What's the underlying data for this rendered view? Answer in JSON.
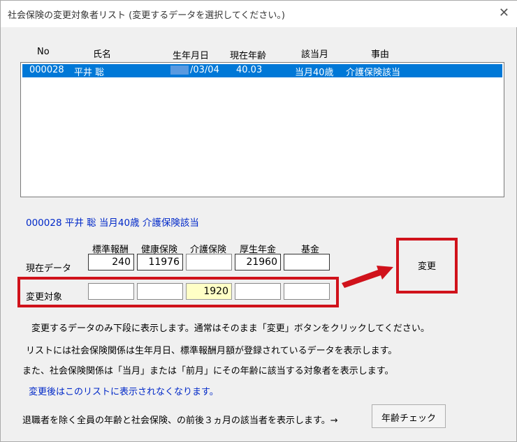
{
  "window": {
    "title": "社会保険の変更対象者リスト (変更するデータを選択してください。)",
    "close_glyph": "✕"
  },
  "list": {
    "headers": {
      "no": "No",
      "name": "氏名",
      "birth": "生年月日",
      "age": "現在年齢",
      "applicable": "該当月",
      "reason": "事由"
    },
    "selected_row": {
      "no": "000028",
      "name": "平井 聡",
      "birth": "/03/04",
      "age": "40.03",
      "applicable": "当月40歳",
      "reason": "介護保険該当"
    }
  },
  "selected_summary": "000028 平井 聡 当月40歳 介護保険該当",
  "grid": {
    "columns": [
      "標準報酬",
      "健康保険",
      "介護保険",
      "厚生年金",
      "基金"
    ],
    "current_label": "現在データ",
    "current_values": [
      "240",
      "11976",
      "",
      "21960",
      ""
    ],
    "change_label": "変更対象",
    "change_values": [
      "",
      "",
      "1920",
      "",
      ""
    ]
  },
  "change_button": "変更",
  "notes": [
    "変更するデータのみ下段に表示します。通常はそのまま「変更」ボタンをクリックしてください。",
    "リストには社会保険関係は生年月日、標準報酬月額が登録されているデータを表示します。",
    "また、社会保険関係は「当月」または「前月」にその年齢に該当する対象者を表示します。"
  ],
  "blue_note": "変更後はこのリストに表示されなくなります。",
  "footer_text": "退職者を除く全員の年齢と社会保険、の前後３ヵ月の該当者を表示します。→",
  "age_check_button": "年齢チェック",
  "colors": {
    "selection": "#0078d7",
    "annotation_red": "#d0121b",
    "highlight_field": "#ffffc6",
    "blue_text": "#0028c8"
  }
}
